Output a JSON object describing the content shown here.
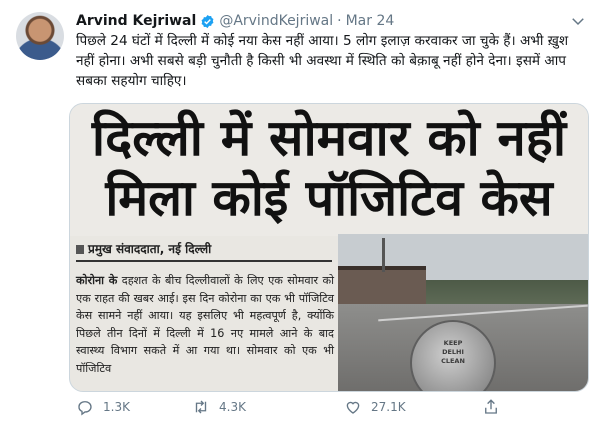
{
  "tweet": {
    "author_name": "Arvind Kejriwal",
    "handle": "@ArvindKejriwal",
    "separator": "·",
    "date": "Mar 24",
    "text": "पिछले 24 घंटों में दिल्ली में कोई नया केस नहीं आया। 5 लोग इलाज़ करवाकर जा चुके हैं। अभी ख़ुश नहीं होना। अभी सबसे बड़ी चुनौती है किसी भी अवस्था में स्थिति को बेक़ाबू नहीं होने देना। इसमें आप सबका सहयोग चाहिए।"
  },
  "media": {
    "headline_line1": "दिल्ली में सोमवार को नहीं",
    "headline_line2": "मिला कोई पॉजिटिव केस",
    "byline": "प्रमुख संवाददाता, नई दिल्ली",
    "article_lead": "कोरोना के",
    "article_body": " दहशत के बीच दिल्लीवालों के लिए एक सोमवार को एक राहत की खबर आई। इस दिन कोरोना का एक भी पॉजिटिव केस सामने नहीं आया। यह इसलिए भी महत्वपूर्ण है, क्योंकि पिछले तीन दिनों में दिल्ली में 16 नए मामले आने के बाद स्वास्थ्य विभाग सकते में आ गया था। सोमवार को एक भी पॉजिटिव",
    "sign_line1": "KEEP",
    "sign_line2": "DELHI",
    "sign_line3": "CLEAN"
  },
  "actions": {
    "reply_count": "1.3K",
    "retweet_count": "4.3K",
    "like_count": "27.1K"
  },
  "colors": {
    "verified": "#1da1f2",
    "secondary_text": "#657786"
  }
}
